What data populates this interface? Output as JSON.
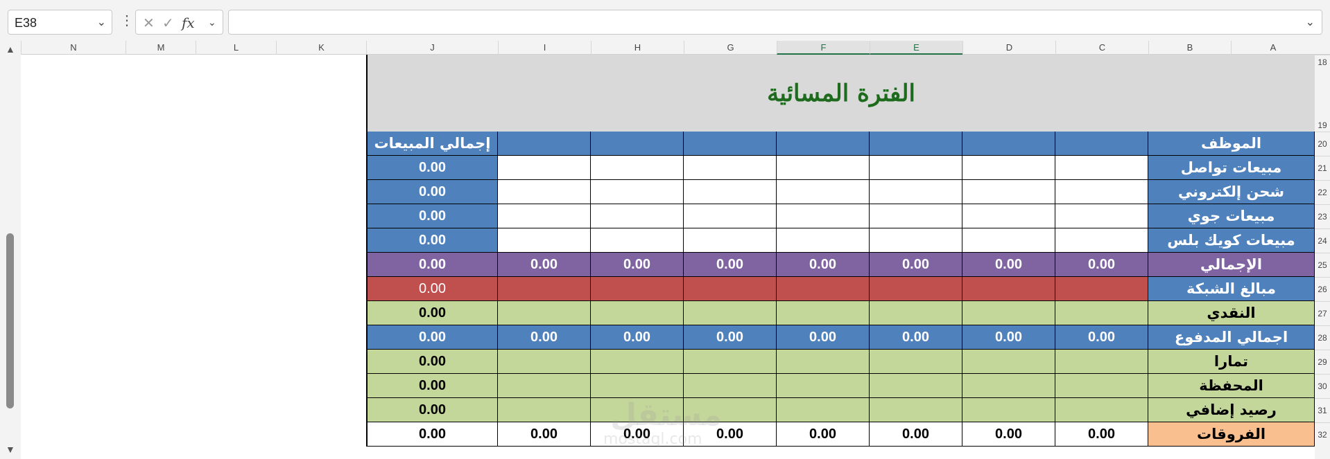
{
  "formula_bar": {
    "name_box": "E38",
    "fx_label": "fx",
    "formula": ""
  },
  "columns": [
    "N",
    "M",
    "L",
    "K",
    "J",
    "I",
    "H",
    "G",
    "F",
    "E",
    "D",
    "C",
    "B",
    "A"
  ],
  "rows": [
    "18",
    "19",
    "20",
    "21",
    "22",
    "23",
    "24",
    "25",
    "26",
    "27",
    "28",
    "29",
    "30",
    "31",
    "32"
  ],
  "sheet": {
    "title": "الفترة المسائية",
    "header_label": "الموظف",
    "total_header": "إجمالي المبيعات",
    "row_labels": [
      "مبيعات تواصل",
      "شحن إلكتروني",
      "مبيعات جوي",
      "مبيعات كويك بلس",
      "الإجمالي",
      "مبالغ الشبكة",
      "النقدي",
      "اجمالي المدفوع",
      "تمارا",
      "المحفظة",
      "رصيد إضافي",
      "الفروقات"
    ],
    "totals_column": [
      "0.00",
      "0.00",
      "0.00",
      "0.00",
      "0.00",
      "0.00",
      "0.00",
      "0.00",
      "0.00",
      "0.00",
      "0.00",
      "0.00"
    ],
    "grand_total_row_values": [
      "0.00",
      "0.00",
      "0.00",
      "0.00",
      "0.00",
      "0.00",
      "0.00"
    ],
    "paid_total_row_values": [
      "0.00",
      "0.00",
      "0.00",
      "0.00",
      "0.00",
      "0.00",
      "0.00"
    ],
    "differences_row_values": [
      "0.00",
      "0.00",
      "0.00",
      "0.00",
      "0.00",
      "0.00",
      "0.00"
    ]
  },
  "colors": {
    "header_blue": "#4f81bd",
    "total_purple": "#8064a2",
    "network_red": "#c0504d",
    "cash_green": "#c4d79b",
    "diff_peach": "#fabf8f",
    "title_green": "#1e6b1e"
  },
  "watermark": {
    "text": "مستقل",
    "sub": "mostaql.com"
  }
}
